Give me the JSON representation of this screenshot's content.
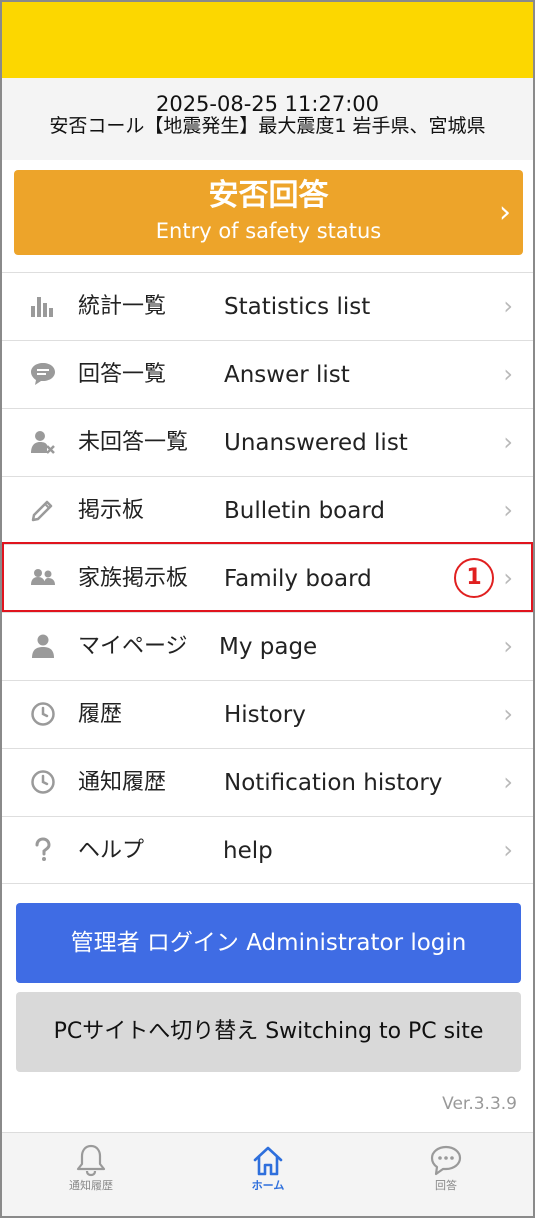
{
  "header": {
    "datetime": "2025-08-25 11:27:00",
    "message": "安否コール【地震発生】最大震度1 岩手県、宮城県"
  },
  "cta": {
    "title": "安否回答",
    "subtitle": "Entry of safety status",
    "chevron": "›"
  },
  "menu": {
    "items": [
      {
        "icon": "bar-chart-icon",
        "ja": "統計一覧",
        "en": "Statistics list"
      },
      {
        "icon": "speech-bubble-icon",
        "ja": "回答一覧",
        "en": "Answer list"
      },
      {
        "icon": "user-x-icon",
        "ja": "未回答一覧",
        "en": "Unanswered list"
      },
      {
        "icon": "pencil-icon",
        "ja": "掲示板",
        "en": "Bulletin board"
      },
      {
        "icon": "family-icon",
        "ja": "家族掲示板",
        "en": "Family board",
        "badge": "1"
      },
      {
        "icon": "user-icon",
        "ja": "マイページ",
        "en": "My page"
      },
      {
        "icon": "clock-icon",
        "ja": "履歴",
        "en": "History"
      },
      {
        "icon": "clock-icon",
        "ja": "通知履歴",
        "en": "Notification history"
      },
      {
        "icon": "question-icon",
        "ja": "ヘルプ",
        "en": "help"
      }
    ],
    "chevron": "›",
    "icon_color": "#9a9a9a"
  },
  "buttons": {
    "admin_login": "管理者 ログイン Administrator login",
    "pc_switch": "PCサイトへ切り替え Switching to PC site"
  },
  "version": "Ver.3.3.9",
  "tabbar": {
    "tabs": [
      {
        "icon": "bell-icon",
        "label": "通知履歴"
      },
      {
        "icon": "home-icon",
        "label": "ホーム",
        "active": true
      },
      {
        "icon": "chat-icon",
        "label": "回答"
      }
    ]
  },
  "colors": {
    "topbar": "#FCD700",
    "cta": "#EDA42A",
    "admin": "#3F6CE4",
    "highlight": "#E0141E",
    "active_tab": "#2E6FDC"
  }
}
